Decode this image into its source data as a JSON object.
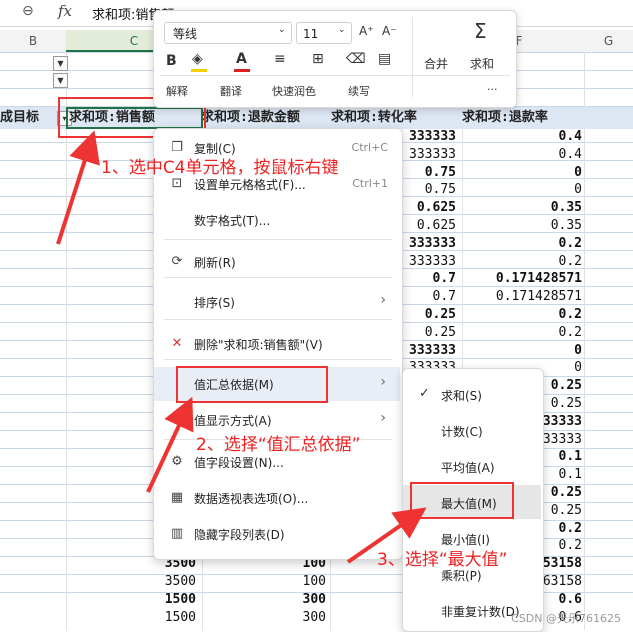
{
  "formula_bar": {
    "zoom_icon": "magnifier-icon",
    "fx": "fx",
    "content": "求和项:销售额"
  },
  "columns": [
    "B",
    "C",
    "F",
    "G"
  ],
  "pivot_headers": [
    "成目标",
    "求和项:销售额",
    "求和项:退款金额",
    "求和项:转化率",
    "求和项:退款率"
  ],
  "rows": [
    {
      "c": "",
      "d": "",
      "e": "333333",
      "f": "0.4",
      "bold": true
    },
    {
      "c": "",
      "d": "",
      "e": "333333",
      "f": "0.4",
      "bold": false
    },
    {
      "c": "",
      "d": "",
      "e": "0.75",
      "f": "0",
      "bold": true
    },
    {
      "c": "",
      "d": "",
      "e": "0.75",
      "f": "0",
      "bold": false
    },
    {
      "c": "",
      "d": "",
      "e": "0.625",
      "f": "0.35",
      "bold": true
    },
    {
      "c": "",
      "d": "",
      "e": "0.625",
      "f": "0.35",
      "bold": false
    },
    {
      "c": "",
      "d": "",
      "e": "333333",
      "f": "0.2",
      "bold": true
    },
    {
      "c": "",
      "d": "",
      "e": "333333",
      "f": "0.2",
      "bold": false
    },
    {
      "c": "",
      "d": "",
      "e": "0.7",
      "f": "0.171428571",
      "bold": true
    },
    {
      "c": "",
      "d": "",
      "e": "0.7",
      "f": "0.171428571",
      "bold": false
    },
    {
      "c": "",
      "d": "",
      "e": "0.25",
      "f": "0.2",
      "bold": true
    },
    {
      "c": "",
      "d": "",
      "e": "0.25",
      "f": "0.2",
      "bold": false
    },
    {
      "c": "",
      "d": "",
      "e": "333333",
      "f": "0",
      "bold": true
    },
    {
      "c": "",
      "d": "",
      "e": "333333",
      "f": "0",
      "bold": false
    },
    {
      "c": "",
      "d": "",
      "e": "",
      "f": "0.25",
      "bold": true
    },
    {
      "c": "",
      "d": "",
      "e": "",
      "f": "0.25",
      "bold": false
    },
    {
      "c": "",
      "d": "",
      "e": "",
      "f": "33333",
      "bold": true
    },
    {
      "c": "",
      "d": "",
      "e": "",
      "f": "33333",
      "bold": false
    },
    {
      "c": "",
      "d": "",
      "e": "",
      "f": "0.1",
      "bold": true
    },
    {
      "c": "",
      "d": "",
      "e": "",
      "f": "0.1",
      "bold": false
    },
    {
      "c": "",
      "d": "",
      "e": "",
      "f": "0.25",
      "bold": true
    },
    {
      "c": "",
      "d": "",
      "e": "",
      "f": "0.25",
      "bold": false
    },
    {
      "c": "",
      "d": "",
      "e": "",
      "f": "0.2",
      "bold": true
    },
    {
      "c": "",
      "d": "",
      "e": "",
      "f": "0.2",
      "bold": false
    },
    {
      "c": "3500",
      "d": "100",
      "e": "0.",
      "f": "53158",
      "bold": true
    },
    {
      "c": "3500",
      "d": "100",
      "e": "0.",
      "f": "63158",
      "bold": false
    },
    {
      "c": "1500",
      "d": "300",
      "e": "0.8333",
      "f": "0.6",
      "bold": true
    },
    {
      "c": "1500",
      "d": "300",
      "e": "0.833",
      "f": "0.6",
      "bold": false
    }
  ],
  "toolbar": {
    "font_name": "等线",
    "font_size": "11",
    "grow_font": "A⁺",
    "shrink_font": "A⁻",
    "sum_label": "求和",
    "merge_label": "合并",
    "bold": "B",
    "items": [
      "解释",
      "翻译",
      "快速润色",
      "续写"
    ],
    "more": "···",
    "font_color": "#e02020",
    "fill_color": "#f5d000"
  },
  "context_menu": [
    {
      "label": "复制(C)",
      "shortcut": "Ctrl+C",
      "icon": "copy-icon",
      "glyph": "❐"
    },
    {
      "label": "设置单元格格式(F)...",
      "shortcut": "Ctrl+1",
      "icon": "format-cells-icon",
      "glyph": "⊡"
    },
    {
      "label": "数字格式(T)...",
      "shortcut": "",
      "icon": "",
      "glyph": ""
    },
    {
      "label": "刷新(R)",
      "shortcut": "",
      "icon": "refresh-icon",
      "glyph": "⟳"
    },
    {
      "label": "排序(S)",
      "shortcut": "",
      "icon": "",
      "glyph": "",
      "arrow": true
    },
    {
      "label": "删除\"求和项:销售额\"(V)",
      "shortcut": "",
      "icon": "delete-icon",
      "glyph": "✕"
    },
    {
      "label": "值汇总依据(M)",
      "shortcut": "",
      "icon": "",
      "glyph": "",
      "arrow": true
    },
    {
      "label": "值显示方式(A)",
      "shortcut": "",
      "icon": "",
      "glyph": "",
      "arrow": true
    },
    {
      "label": "值字段设置(N)...",
      "shortcut": "",
      "icon": "field-settings-icon",
      "glyph": "⚙"
    },
    {
      "label": "数据透视表选项(O)...",
      "shortcut": "",
      "icon": "pivot-options-icon",
      "glyph": "▦"
    },
    {
      "label": "隐藏字段列表(D)",
      "shortcut": "",
      "icon": "field-list-icon",
      "glyph": "▥"
    }
  ],
  "submenu": [
    {
      "label": "求和(S)",
      "checked": true
    },
    {
      "label": "计数(C)",
      "checked": false
    },
    {
      "label": "平均值(A)",
      "checked": false
    },
    {
      "label": "最大值(M)",
      "checked": false
    },
    {
      "label": "最小值(I)",
      "checked": false
    },
    {
      "label": "乘积(P)",
      "checked": false
    },
    {
      "label": "非重复计数(D)",
      "checked": false
    }
  ],
  "annotations": {
    "step1": "1、选中C4单元格，按鼠标右键",
    "step2": "2、选择“值汇总依据”",
    "step3": "3、选择“最大值”",
    "accent": "#e02424"
  },
  "watermark": "CSDN @天乐761625"
}
